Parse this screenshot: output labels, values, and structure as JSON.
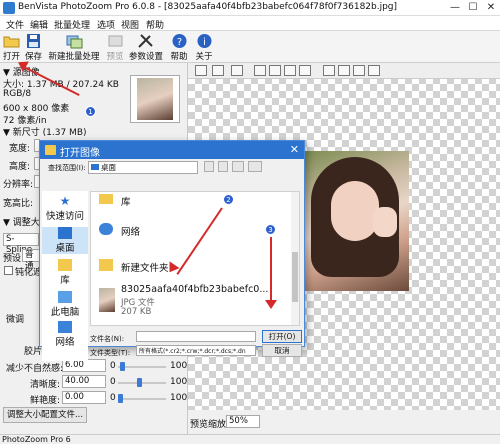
{
  "window": {
    "title": "BenVista PhotoZoom Pro 6.0.8 - [83025aafa40f4bfb23babefc064f78f0f736182b.jpg]",
    "controls": [
      "—",
      "☐",
      "✕"
    ]
  },
  "menu": [
    "文件",
    "编辑",
    "批量处理",
    "选项",
    "视图",
    "帮助"
  ],
  "toolbar": {
    "open": "打开",
    "save": "保存",
    "new_batch": "新建批量处理",
    "preview": "预览",
    "params": "参数设置",
    "help": "帮助",
    "about": "关于"
  },
  "left_panel": {
    "source_section": "▼ 源图像",
    "size_line": "大小: 1.37 MB / 207.24 KB",
    "color_mode": "RGB/8",
    "pixels": "600 x 800 像素",
    "dpi": "72 像素/in",
    "new_size_section": "▼ 新尺寸 (1.37 MB)",
    "width_label": "宽度:",
    "height_label": "高度:",
    "resolution_label": "分辨率:",
    "aspect_label": "宽高比:",
    "resize_section": "▼ 调整大小",
    "method_value": "S-Spline",
    "preset_label": "预设:",
    "preset_value": "普通",
    "sharpen_label": "钝化遮",
    "fine_label": "微调",
    "film_label": "胶片",
    "reduce_label": "减少不自然感:",
    "reduce_value": "6.00",
    "clarity_label": "清晰度:",
    "clarity_value": "40.00",
    "vivid_label": "鲜艳度:",
    "vivid_value": "0.00",
    "slider_min": "0",
    "slider_max": "100",
    "profile_button": "调整大小配置文件..."
  },
  "preview": {
    "zoom_label": "预览缩放:",
    "zoom_value": "50%"
  },
  "status": "PhotoZoom Pro 6",
  "dialog": {
    "title": "打开图像",
    "lookin_label": "查找范围(I):",
    "lookin_value": "桌面",
    "nav": [
      "快速访问",
      "桌面",
      "库",
      "此电脑",
      "网络"
    ],
    "files": [
      {
        "name": "库",
        "type": "folder"
      },
      {
        "name": "网络",
        "type": "network"
      },
      {
        "name": "新建文件夹",
        "type": "folder"
      },
      {
        "name": "83025aafa40f4bfb23babefc0...",
        "sub1": "JPG 文件",
        "sub2": "207 KB"
      }
    ],
    "filename_label": "文件名(N):",
    "filetype_label": "文件类型(T):",
    "filetype_value": "所有格式(*.cr2;*.crw;*.dcr;*.dcs;*.dn",
    "open_button": "打开(O)",
    "cancel_button": "取消"
  },
  "annotations": [
    "1",
    "2",
    "3"
  ],
  "colors": {
    "accent": "#2b73cf",
    "arrow": "#d42a2a",
    "badge": "#2c5fcf"
  }
}
